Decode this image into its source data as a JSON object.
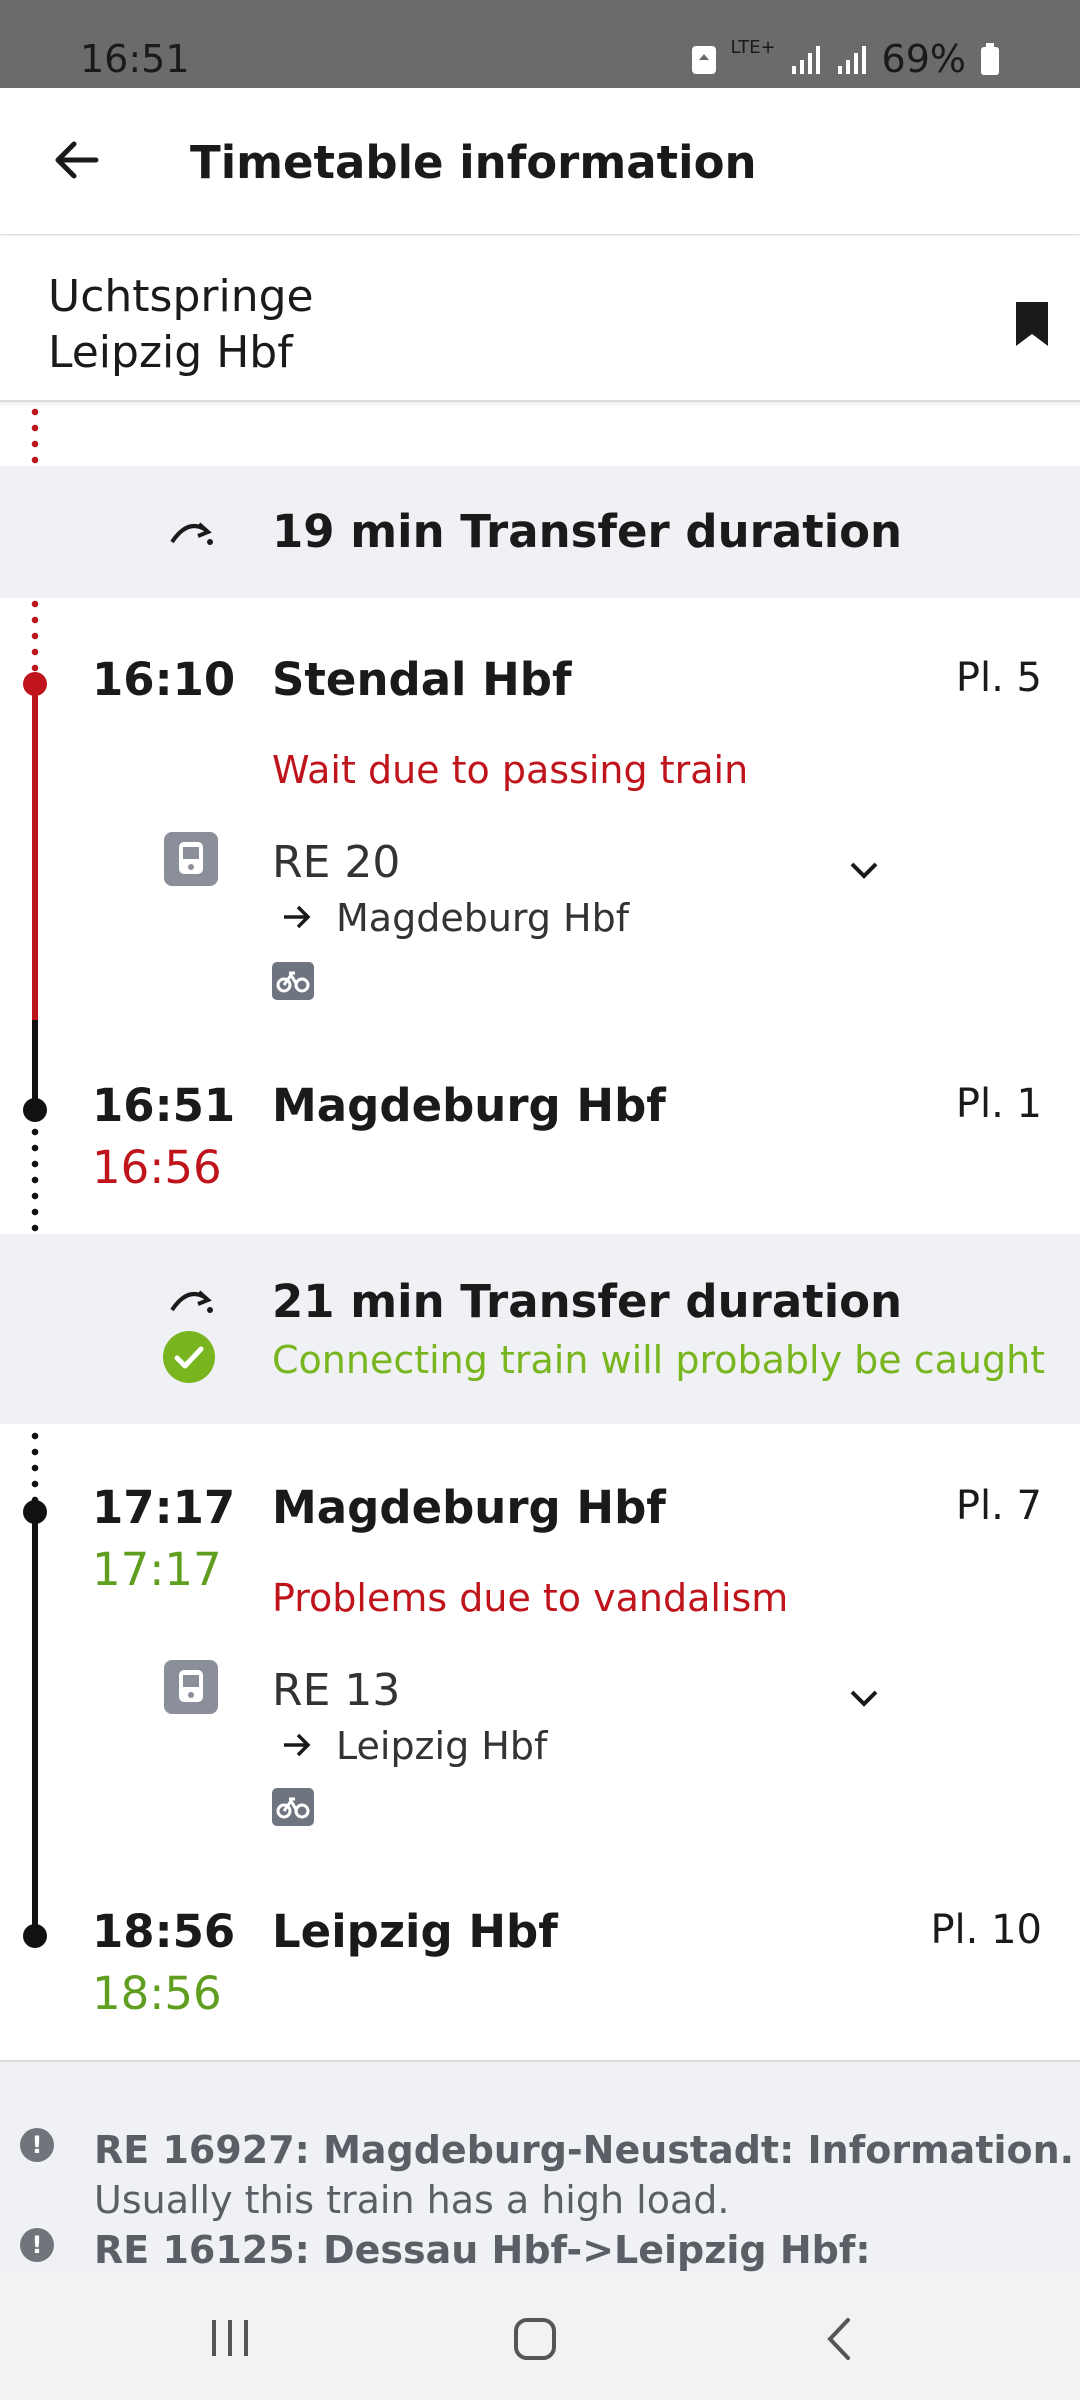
{
  "status": {
    "time": "16:51",
    "network": "LTE+",
    "battery": "69%"
  },
  "appbar": {
    "title": "Timetable information"
  },
  "route": {
    "from": "Uchtspringe",
    "to": "Leipzig Hbf"
  },
  "transfers": [
    {
      "duration": "19 min Transfer duration"
    },
    {
      "duration": "21 min Transfer duration",
      "status": "Connecting train will probably be caught"
    }
  ],
  "stops": [
    {
      "time": "16:10",
      "station": "Stendal Hbf",
      "platform": "Pl. 5",
      "message": "Wait due to passing train"
    },
    {
      "time": "16:51",
      "time_actual": "16:56",
      "station": "Magdeburg Hbf",
      "platform": "Pl. 1"
    },
    {
      "time": "17:17",
      "time_actual": "17:17",
      "station": "Magdeburg Hbf",
      "platform": "Pl. 7",
      "message": "Problems due to vandalism"
    },
    {
      "time": "18:56",
      "time_actual": "18:56",
      "station": "Leipzig Hbf",
      "platform": "Pl. 10"
    }
  ],
  "trains": [
    {
      "name": "RE 20",
      "destination": "Magdeburg Hbf"
    },
    {
      "name": "RE 13",
      "destination": "Leipzig Hbf"
    }
  ],
  "info": [
    {
      "title": "RE 16927: Magdeburg-Neustadt: Information.",
      "text": "Usually this train has a high load."
    },
    {
      "title": "RE 16125: Dessau Hbf->Leipzig Hbf:"
    }
  ],
  "colors": {
    "delay": "#c0141c",
    "ontime": "#5f9e1e",
    "ok": "#78b51f",
    "band": "#eff1f4"
  }
}
